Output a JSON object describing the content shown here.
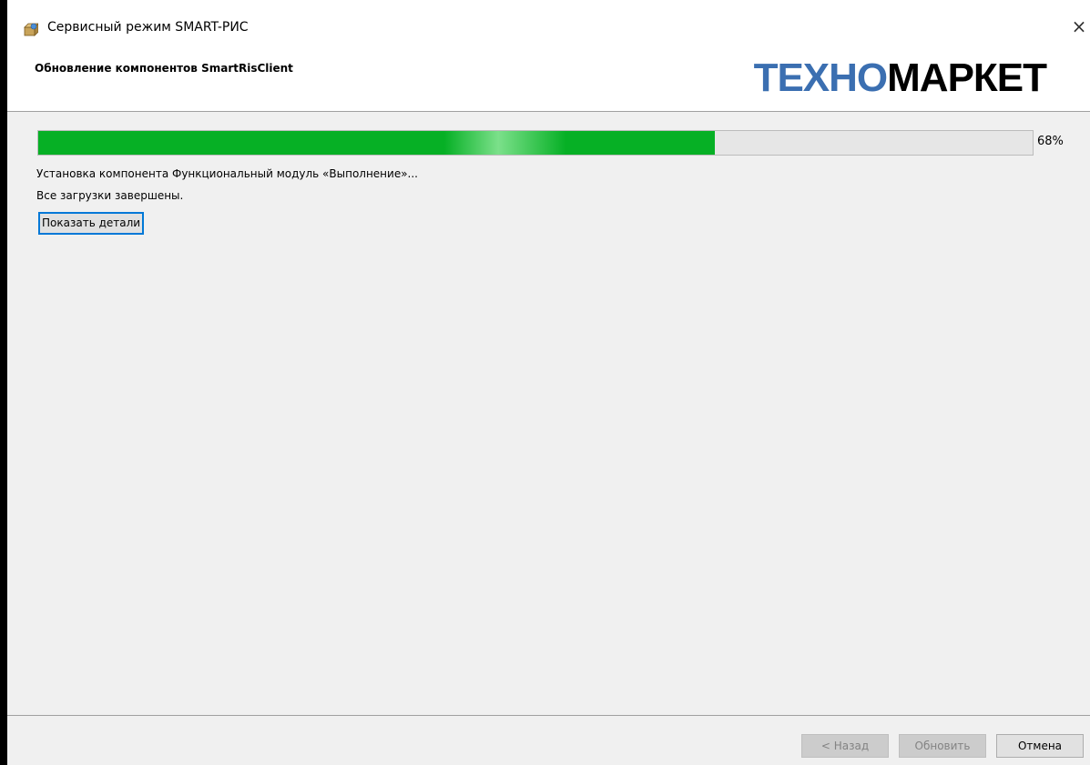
{
  "window": {
    "title": "Сервисный режим SMART-РИС",
    "close_label": "×"
  },
  "header": {
    "title": "Обновление компонентов SmartRisClient",
    "logo_part1": "ТЕХНО",
    "logo_part2": "МАРКЕТ"
  },
  "progress": {
    "value": 0.68,
    "label": "68%",
    "fill_color": "#06b025"
  },
  "status": {
    "line1": "Установка компонента Функциональный модуль «Выполнение»...",
    "line2": "Все загрузки завершены."
  },
  "details_button": {
    "label": "Показать детали"
  },
  "footer": {
    "back_label": "< Назад",
    "update_label": "Обновить",
    "cancel_label": "Отмена"
  },
  "icons": {
    "app": "installer-package-icon",
    "close": "close-icon"
  }
}
